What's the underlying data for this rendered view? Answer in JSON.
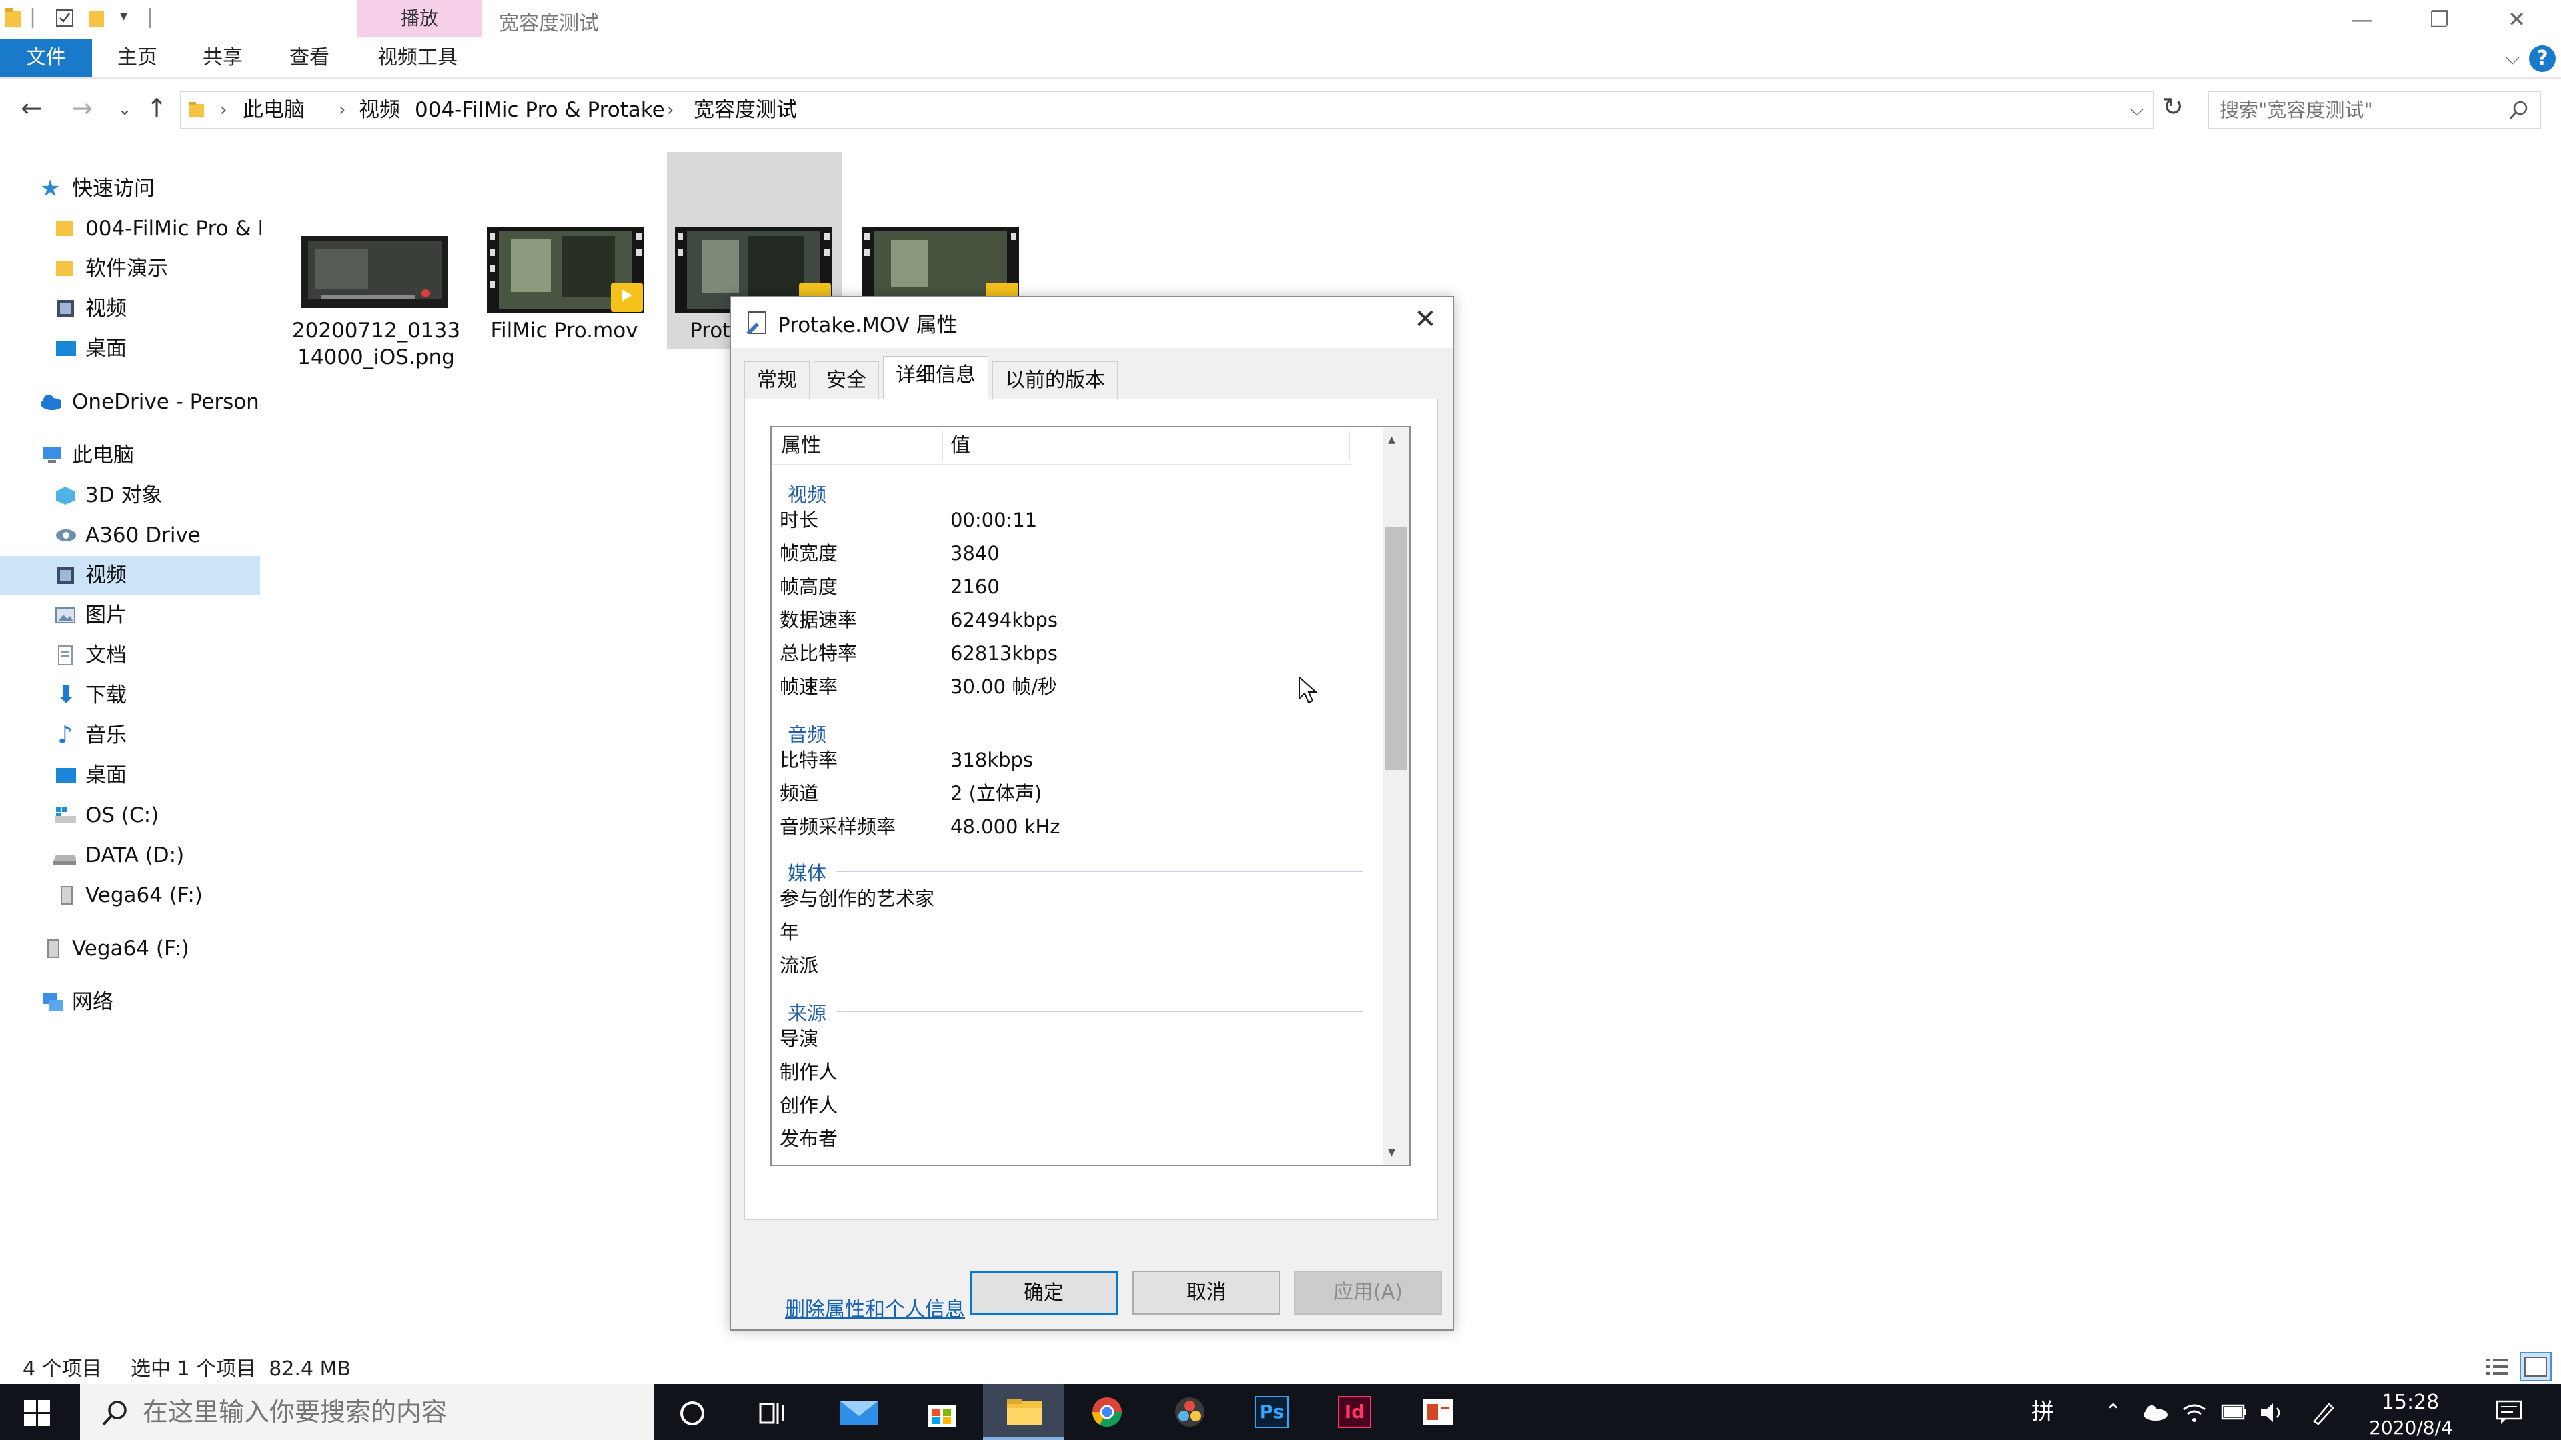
{
  "titlebar": {
    "context_tab": "播放",
    "window_title": "宽容度测试"
  },
  "ribbon": {
    "tabs": [
      "文件",
      "主页",
      "共享",
      "查看",
      "视频工具"
    ]
  },
  "address": {
    "crumbs": [
      "此电脑",
      "视频",
      "004-FilMic Pro & Protake",
      "宽容度测试"
    ]
  },
  "search": {
    "placeholder": "搜索\"宽容度测试\""
  },
  "nav": {
    "quick_access": "快速访问",
    "qa_items": [
      "004-FilMic Pro & F",
      "软件演示",
      "视频",
      "桌面"
    ],
    "onedrive": "OneDrive - Persona",
    "this_pc": "此电脑",
    "pc_items": [
      "3D 对象",
      "A360 Drive",
      "视频",
      "图片",
      "文档",
      "下载",
      "音乐",
      "桌面",
      "OS (C:)",
      "DATA (D:)",
      "Vega64 (F:)"
    ],
    "vega": "Vega64 (F:)",
    "network": "网络"
  },
  "files": [
    {
      "name1": "20200712_0133",
      "name2": "14000_iOS.png"
    },
    {
      "name1": "FilMic Pro.mov",
      "name2": ""
    },
    {
      "name1": "Prot",
      "name2": ""
    },
    {
      "name1": "",
      "name2": ""
    }
  ],
  "status": {
    "count": "4 个项目",
    "selected": "选中 1 个项目  82.4 MB"
  },
  "taskbar": {
    "search_placeholder": "在这里输入你要搜索的内容",
    "time": "15:28",
    "date": "2020/8/4",
    "ime": "拼"
  },
  "dialog": {
    "title": "Protake.MOV 属性",
    "tabs": [
      "常规",
      "安全",
      "详细信息",
      "以前的版本"
    ],
    "active_tab": 2,
    "col_property": "属性",
    "col_value": "值",
    "groups": {
      "video": "视频",
      "audio": "音频",
      "media": "媒体",
      "origin": "来源"
    },
    "video_rows": [
      {
        "k": "时长",
        "v": "00:00:11"
      },
      {
        "k": "帧宽度",
        "v": "3840"
      },
      {
        "k": "帧高度",
        "v": "2160"
      },
      {
        "k": "数据速率",
        "v": "62494kbps"
      },
      {
        "k": "总比特率",
        "v": "62813kbps"
      },
      {
        "k": "帧速率",
        "v": "30.00 帧/秒"
      }
    ],
    "audio_rows": [
      {
        "k": "比特率",
        "v": "318kbps"
      },
      {
        "k": "频道",
        "v": "2 (立体声)"
      },
      {
        "k": "音频采样频率",
        "v": "48.000 kHz"
      }
    ],
    "media_rows": [
      {
        "k": "参与创作的艺术家",
        "v": ""
      },
      {
        "k": "年",
        "v": ""
      },
      {
        "k": "流派",
        "v": ""
      }
    ],
    "origin_rows": [
      {
        "k": "导演",
        "v": ""
      },
      {
        "k": "制作人",
        "v": ""
      },
      {
        "k": "创作人",
        "v": ""
      },
      {
        "k": "发布者",
        "v": ""
      }
    ],
    "remove_link": "删除属性和个人信息",
    "ok": "确定",
    "cancel": "取消",
    "apply": "应用(A)"
  }
}
